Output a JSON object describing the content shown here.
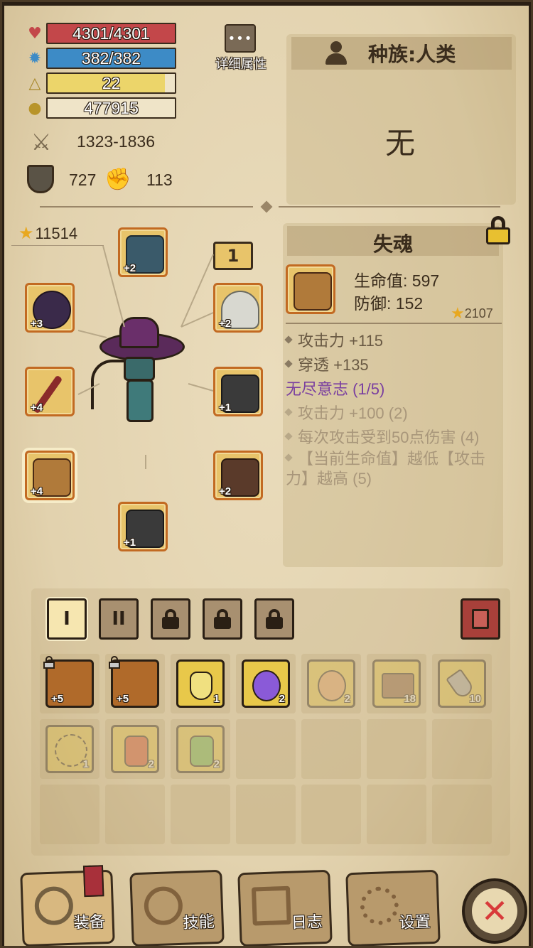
{
  "colors": {
    "hp": "#c3474a",
    "mp": "#3d8bc6",
    "level": "#ecd56a",
    "accent_purple": "#7a3fa0",
    "parchment": "#e6d6b2"
  },
  "stats": {
    "hp": {
      "text": "4301/4301",
      "fraction": 1.0,
      "icon": "heart-icon"
    },
    "mp": {
      "text": "382/382",
      "fraction": 1.0,
      "icon": "gear-icon"
    },
    "level": {
      "text": "22",
      "fraction": 0.92,
      "icon": "triangle-icon"
    },
    "gold": {
      "text": "477915",
      "icon": "gold-icon"
    },
    "attack": {
      "text": "1323-1836",
      "icon": "crossed-swords-icon"
    },
    "defense": {
      "text": "727",
      "icon": "shield-icon"
    },
    "magic": {
      "text": "113",
      "icon": "fist-icon"
    }
  },
  "detail_button": {
    "dots": "•••",
    "label": "详细属性"
  },
  "race": {
    "title": "种族:人类",
    "value": "无"
  },
  "equipment": {
    "score": "11514",
    "page_badge": "1",
    "slots": [
      {
        "name": "helmet",
        "plus": "+2"
      },
      {
        "name": "ring",
        "plus": "+3"
      },
      {
        "name": "wings",
        "plus": "+2"
      },
      {
        "name": "sword",
        "plus": "+4"
      },
      {
        "name": "armor",
        "plus": "+1"
      },
      {
        "name": "bracer",
        "plus": "+4"
      },
      {
        "name": "pants",
        "plus": "+2"
      },
      {
        "name": "boots",
        "plus": "+1"
      }
    ]
  },
  "item_detail": {
    "name": "失魂",
    "stat1": "生命值: 597",
    "stat2": "防御: 152",
    "score": "2107",
    "effects": [
      {
        "text": "攻击力 +115",
        "active": true
      },
      {
        "text": "穿透 +135",
        "active": true
      }
    ],
    "set_name": "无尽意志 (1/5)",
    "set_effects": [
      {
        "text": "攻击力 +100 (2)"
      },
      {
        "text": "每次攻击受到50点伤害 (4)"
      },
      {
        "text": "【当前生命值】越低【攻击力】越高 (5)"
      }
    ]
  },
  "bag": {
    "tabs": [
      "I",
      "II"
    ],
    "items": [
      {
        "name": "hat",
        "plus": "+5",
        "count": "",
        "locked": true
      },
      {
        "name": "crossbow",
        "plus": "+5",
        "count": "",
        "locked": true
      },
      {
        "name": "potion-gold",
        "count": "1"
      },
      {
        "name": "potion-purple",
        "count": "2"
      },
      {
        "name": "potion-orange",
        "count": "2"
      },
      {
        "name": "chest",
        "count": "18"
      },
      {
        "name": "shovel",
        "count": "10"
      },
      {
        "name": "web",
        "count": "1"
      },
      {
        "name": "potion-red",
        "count": "2"
      },
      {
        "name": "potion-green",
        "count": "2"
      }
    ]
  },
  "nav": {
    "equip": "装备",
    "skills": "技能",
    "log": "日志",
    "settings": "设置"
  }
}
